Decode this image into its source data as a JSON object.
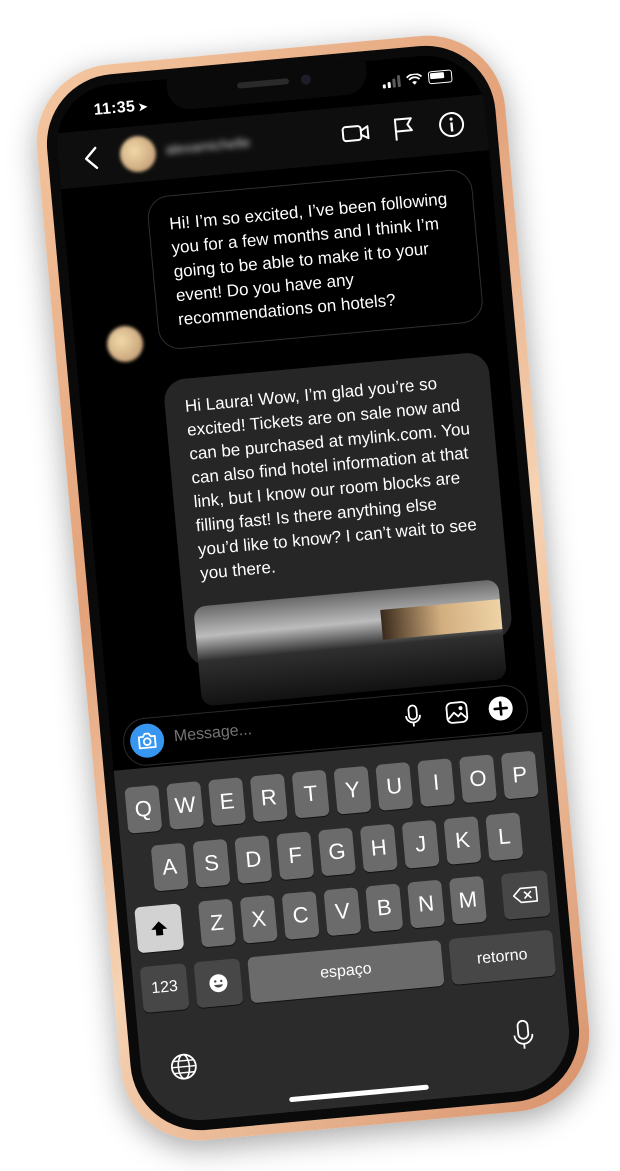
{
  "status": {
    "time": "11:35"
  },
  "header": {
    "username": "alexamichelle"
  },
  "messages": [
    {
      "text": "Hi! I’m so excited, I’ve been following you for a few months and I think I’m going to be able to make it to your event! Do you have any recommendations on hotels?"
    },
    {
      "text": "Hi Laura! Wow, I’m glad you’re so excited! Tickets are on sale now and can be purchased at mylink.com. You can also find hotel information at that link, but I know our room blocks are filling fast! Is there anything else you’d like to know? I can’t wait to see you there."
    }
  ],
  "composer": {
    "placeholder": "Message..."
  },
  "keyboard": {
    "row1": [
      "Q",
      "W",
      "E",
      "R",
      "T",
      "Y",
      "U",
      "I",
      "O",
      "P"
    ],
    "row2": [
      "A",
      "S",
      "D",
      "F",
      "G",
      "H",
      "J",
      "K",
      "L"
    ],
    "row3": [
      "Z",
      "X",
      "C",
      "V",
      "B",
      "N",
      "M"
    ],
    "numbers_label": "123",
    "space_label": "espaço",
    "return_label": "retorno"
  },
  "colors": {
    "accent": "#3797f0",
    "bubble_incoming": "#262626",
    "frame": "#e3a27a"
  },
  "icons": [
    "location-arrow-icon",
    "wifi-icon",
    "battery-icon",
    "back-icon",
    "video-call-icon",
    "flag-icon",
    "info-icon",
    "camera-icon",
    "microphone-icon",
    "gallery-icon",
    "add-icon",
    "shift-icon",
    "backspace-icon",
    "emoji-icon",
    "globe-icon",
    "dictation-icon"
  ]
}
